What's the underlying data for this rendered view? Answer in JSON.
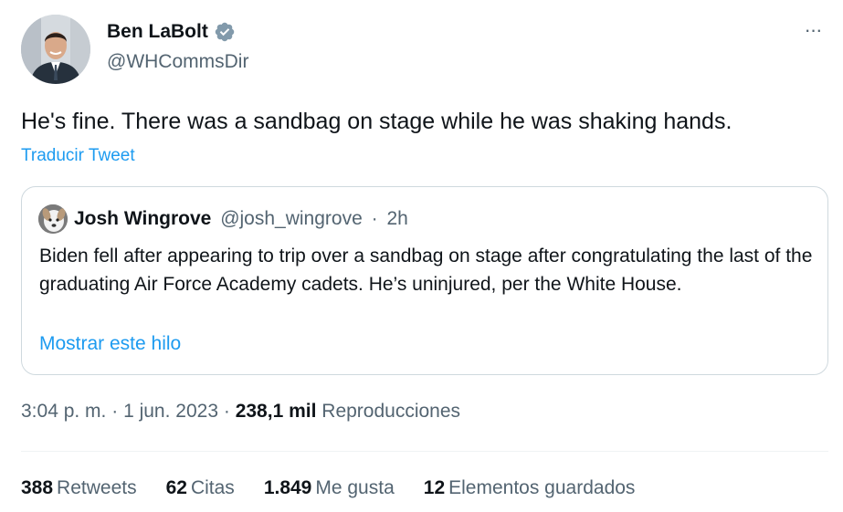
{
  "colors": {
    "text_primary": "#0f1419",
    "text_secondary": "#536471",
    "link": "#1d9bf0",
    "verified_badge": "#829aab",
    "border": "#cfd9de"
  },
  "author": {
    "name": "Ben LaBolt",
    "handle": "@WHCommsDir",
    "avatar_icon": "person-photo-avatar",
    "verified_icon": "verified-badge-icon"
  },
  "more_button": {
    "label": "···",
    "icon": "more-horizontal-icon"
  },
  "tweet": {
    "text": "He's fine. There was a sandbag on stage while he was shaking hands.",
    "translate_label": "Traducir Tweet"
  },
  "quote": {
    "author_name": "Josh Wingrove",
    "author_handle": "@josh_wingrove",
    "separator": "·",
    "time": "2h",
    "avatar_icon": "dog-photo-avatar",
    "text": "Biden fell after appearing to trip over a sandbag on stage after congratulating the last of the graduating Air Force Academy cadets. He’s uninjured, per the White House.",
    "show_thread_label": "Mostrar este hilo"
  },
  "meta": {
    "time": "3:04 p. m.",
    "separator": "·",
    "date": "1 jun. 2023",
    "views_count": "238,1 mil",
    "views_label": "Reproducciones"
  },
  "stats": [
    {
      "count": "388",
      "label": "Retweets"
    },
    {
      "count": "62",
      "label": "Citas"
    },
    {
      "count": "1.849",
      "label": "Me gusta"
    },
    {
      "count": "12",
      "label": "Elementos guardados"
    }
  ]
}
